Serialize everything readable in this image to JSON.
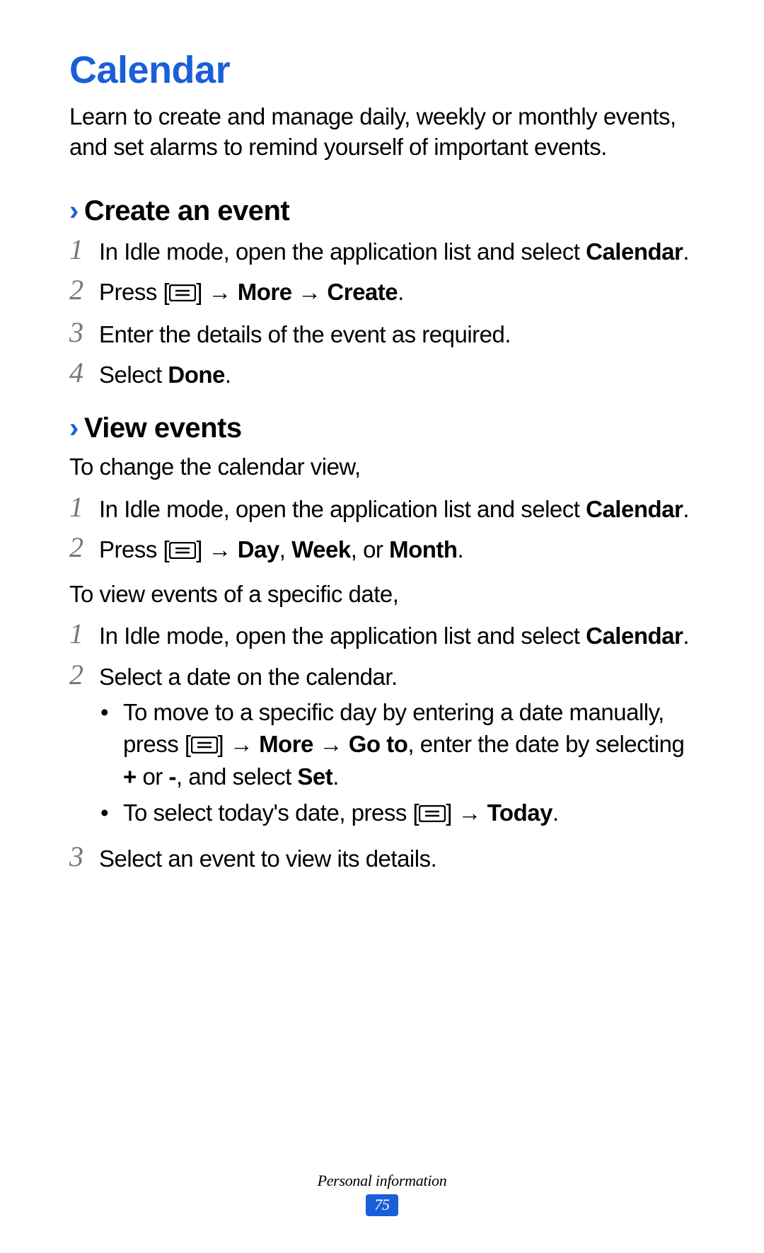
{
  "title": "Calendar",
  "intro": "Learn to create and manage daily, weekly or monthly events, and set alarms to remind yourself of important events.",
  "sections": {
    "create": {
      "heading": "Create an event",
      "steps": {
        "s1a": "In Idle mode, open the application list and select ",
        "s1b": "Calendar",
        "s1c": ".",
        "s2a": "Press [",
        "s2b": "] → ",
        "s2c": "More",
        "s2d": " → ",
        "s2e": "Create",
        "s2f": ".",
        "s3": "Enter the details of the event as required.",
        "s4a": "Select ",
        "s4b": "Done",
        "s4c": "."
      }
    },
    "view": {
      "heading": "View events",
      "lead1": "To change the calendar view,",
      "stepsA": {
        "s1a": "In Idle mode, open the application list and select ",
        "s1b": "Calendar",
        "s1c": ".",
        "s2a": "Press [",
        "s2b": "] → ",
        "s2c": "Day",
        "s2d": ", ",
        "s2e": "Week",
        "s2f": ", or ",
        "s2g": "Month",
        "s2h": "."
      },
      "lead2": "To view events of a specific date,",
      "stepsB": {
        "s1a": "In Idle mode, open the application list and select ",
        "s1b": "Calendar",
        "s1c": ".",
        "s2": "Select a date on the calendar.",
        "b1a": "To move to a specific day by entering a date manually, press [",
        "b1b": "] → ",
        "b1c": "More",
        "b1d": " → ",
        "b1e": "Go to",
        "b1f": ", enter the date by selecting ",
        "b1g": "+",
        "b1h": " or ",
        "b1i": "-",
        "b1j": ", and select ",
        "b1k": "Set",
        "b1l": ".",
        "b2a": "To select today's date, press [",
        "b2b": "] → ",
        "b2c": "Today",
        "b2d": ".",
        "s3": "Select an event to view its details."
      }
    }
  },
  "footer": {
    "section": "Personal information",
    "page": "75"
  },
  "nums": {
    "n1": "1",
    "n2": "2",
    "n3": "3",
    "n4": "4"
  },
  "glyphs": {
    "chevron": "›",
    "bullet": "•"
  }
}
